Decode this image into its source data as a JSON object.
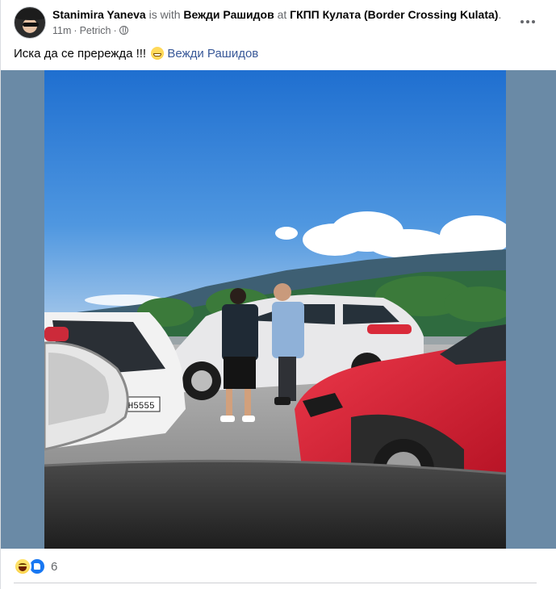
{
  "post": {
    "author": "Stanimira Yaneva",
    "with_text": "is with",
    "tagged_person": "Вежди Рашидов",
    "at_text": "at",
    "location": "ГКПП Кулата (Border Crossing Kulata)",
    "location_suffix": ".",
    "time": "11m",
    "place": "Petrich",
    "privacy_icon": "globe-icon",
    "message": "Иска да се прережда !!!",
    "message_emoji": "grinning-face-emoji",
    "message_tag": "Вежди Рашидов",
    "photo_plate": "PH5555",
    "reactions": {
      "icons": [
        "haha-icon",
        "like-icon"
      ],
      "count": "6"
    }
  },
  "colors": {
    "link": "#385898",
    "muted": "#65676b",
    "photo_backdrop": "#6a8aa6",
    "sky": "#3f88d6",
    "red_car": "#d7253a"
  }
}
